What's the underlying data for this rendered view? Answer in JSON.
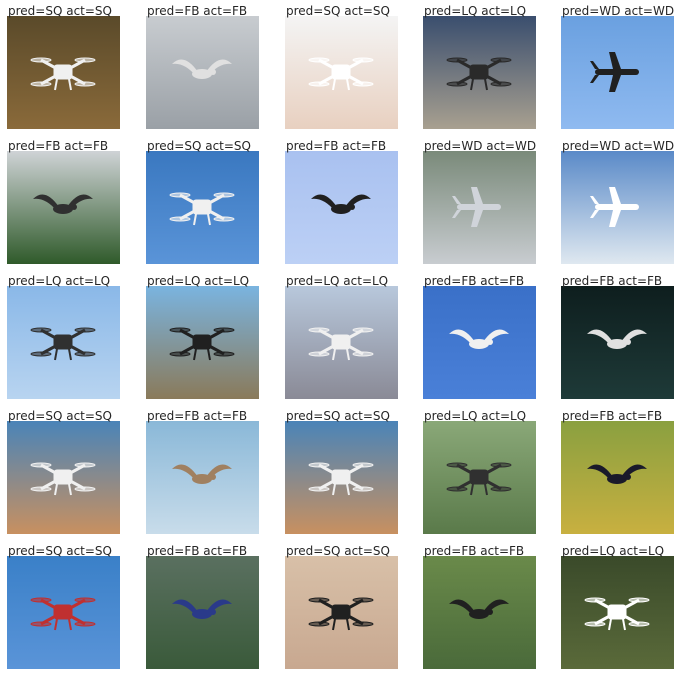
{
  "grid": {
    "rows": 5,
    "cols": 5,
    "cells": [
      {
        "caption": "pred=SQ act=SQ",
        "scene": "quadcopter-white-on-foliage",
        "icon": "drone-icon",
        "colors": [
          "#5a4a2a",
          "#8a6a3a",
          "#f0f0f0"
        ]
      },
      {
        "caption": "pred=FB act=FB",
        "scene": "bird-in-snow-blur",
        "icon": "bird-icon",
        "colors": [
          "#c8ccd0",
          "#9aa0a6",
          "#e0e0e0"
        ]
      },
      {
        "caption": "pred=SQ act=SQ",
        "scene": "hand-launching-quadcopter",
        "icon": "drone-icon",
        "colors": [
          "#f4f4f4",
          "#e8d0c0",
          "#ffffff"
        ]
      },
      {
        "caption": "pred=LQ act=LQ",
        "scene": "drone-at-dusk-over-water",
        "icon": "drone-icon",
        "colors": [
          "#3a4e6e",
          "#a8a090",
          "#2a2a2a"
        ]
      },
      {
        "caption": "pred=WD act=WD",
        "scene": "fixed-wing-in-blue-sky",
        "icon": "plane-icon",
        "colors": [
          "#6aa0e0",
          "#8fbaf0",
          "#202020"
        ]
      },
      {
        "caption": "pred=FB act=FB",
        "scene": "bird-over-treeline",
        "icon": "bird-icon",
        "colors": [
          "#cfd3d6",
          "#2f5a2a",
          "#303030"
        ]
      },
      {
        "caption": "pred=SQ act=SQ",
        "scene": "quadcopter-blue-sky",
        "icon": "drone-icon",
        "colors": [
          "#3a78c0",
          "#5a94d8",
          "#f0f0f0"
        ]
      },
      {
        "caption": "pred=FB act=FB",
        "scene": "raven-on-light-blue",
        "icon": "bird-icon",
        "colors": [
          "#a9c1f0",
          "#bcd0f5",
          "#202020"
        ]
      },
      {
        "caption": "pred=WD act=WD",
        "scene": "flying-wing-over-plaza",
        "icon": "plane-icon",
        "colors": [
          "#7a8a7a",
          "#c8ccd0",
          "#d0d4da"
        ]
      },
      {
        "caption": "pred=WD act=WD",
        "scene": "uav-above-clouds",
        "icon": "plane-icon",
        "colors": [
          "#5a8ac8",
          "#dfe8f0",
          "#ffffff"
        ]
      },
      {
        "caption": "pred=LQ act=LQ",
        "scene": "hexacopter-with-camera",
        "icon": "drone-icon",
        "colors": [
          "#8ab8e8",
          "#b8d4f0",
          "#303030"
        ]
      },
      {
        "caption": "pred=LQ act=LQ",
        "scene": "large-drone-over-town",
        "icon": "drone-icon",
        "colors": [
          "#7ab4e0",
          "#8a7a5a",
          "#202020"
        ]
      },
      {
        "caption": "pred=LQ act=LQ",
        "scene": "drone-over-mountains",
        "icon": "drone-icon",
        "colors": [
          "#b8c8dc",
          "#8a8a96",
          "#f0f0f0"
        ]
      },
      {
        "caption": "pred=FB act=FB",
        "scene": "gull-in-blue-sky",
        "icon": "bird-icon",
        "colors": [
          "#3a70c8",
          "#4a80d8",
          "#f0f0f0"
        ]
      },
      {
        "caption": "pred=FB act=FB",
        "scene": "bird-over-dark-sea",
        "icon": "bird-icon",
        "colors": [
          "#0e1e1e",
          "#1e3a38",
          "#e0e0e0"
        ]
      },
      {
        "caption": "pred=SQ act=SQ",
        "scene": "quadcopter-bokeh",
        "icon": "drone-icon",
        "colors": [
          "#4a84b8",
          "#c89060",
          "#f0f0f0"
        ]
      },
      {
        "caption": "pred=FB act=FB",
        "scene": "tern-over-water",
        "icon": "bird-icon",
        "colors": [
          "#8ab8d8",
          "#c8dcea",
          "#a08060"
        ]
      },
      {
        "caption": "pred=SQ act=SQ",
        "scene": "quadcopter-bokeh-2",
        "icon": "drone-icon",
        "colors": [
          "#4a84b8",
          "#c89060",
          "#f0f0f0"
        ]
      },
      {
        "caption": "pred=LQ act=LQ",
        "scene": "ag-drone-over-field",
        "icon": "drone-icon",
        "colors": [
          "#8aa878",
          "#5a7a4a",
          "#303030"
        ]
      },
      {
        "caption": "pred=FB act=FB",
        "scene": "black-bird-on-plants",
        "icon": "bird-icon",
        "colors": [
          "#8aa040",
          "#c8b040",
          "#1a1a2a"
        ]
      },
      {
        "caption": "pred=SQ act=SQ",
        "scene": "quad-and-plane-toys",
        "icon": "drone-icon",
        "colors": [
          "#3a80c8",
          "#5a94d8",
          "#c03030"
        ]
      },
      {
        "caption": "pred=FB act=FB",
        "scene": "jay-in-flight",
        "icon": "bird-icon",
        "colors": [
          "#5a7060",
          "#3a5a3a",
          "#2a3a8a"
        ]
      },
      {
        "caption": "pred=SQ act=SQ",
        "scene": "drone-blurred-background",
        "icon": "drone-icon",
        "colors": [
          "#d8c0a8",
          "#c8a890",
          "#202020"
        ]
      },
      {
        "caption": "pred=FB act=FB",
        "scene": "puffin-on-grass",
        "icon": "bird-icon",
        "colors": [
          "#6a8a4a",
          "#4a6a3a",
          "#202020"
        ]
      },
      {
        "caption": "pred=LQ act=LQ",
        "scene": "drone-over-crops-topdown",
        "icon": "drone-icon",
        "colors": [
          "#3a4a2a",
          "#5a6a3a",
          "#ffffff"
        ]
      }
    ]
  }
}
